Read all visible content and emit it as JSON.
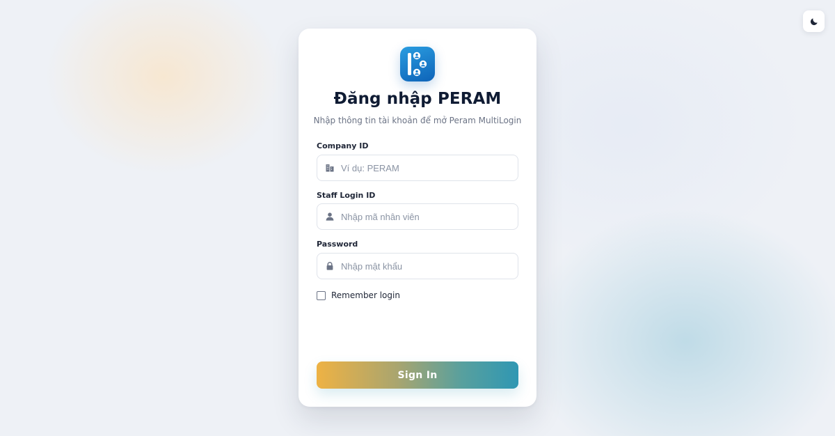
{
  "theme_toggle": {
    "icon": "moon-icon"
  },
  "login": {
    "title": "Đăng nhập PERAM",
    "subtitle": "Nhập thông tin tài khoản để mở Peram MultiLogin",
    "logo_icon": "peram-logo",
    "fields": [
      {
        "label": "Company ID",
        "placeholder": "Ví dụ: PERAM",
        "value": "",
        "icon": "building-icon"
      },
      {
        "label": "Staff Login ID",
        "placeholder": "Nhập mã nhân viên",
        "value": "",
        "icon": "user-icon"
      },
      {
        "label": "Password",
        "placeholder": "Nhập mật khẩu",
        "value": "",
        "icon": "lock-icon"
      }
    ],
    "remember": {
      "label": "Remember login",
      "checked": false
    },
    "submit_label": "Sign In"
  },
  "colors": {
    "logo": "#1a7fd0",
    "button_gradient": [
      "#eeb244",
      "#2f97b3"
    ],
    "text_primary": "#0f1b33",
    "text_muted": "#6b7385"
  }
}
